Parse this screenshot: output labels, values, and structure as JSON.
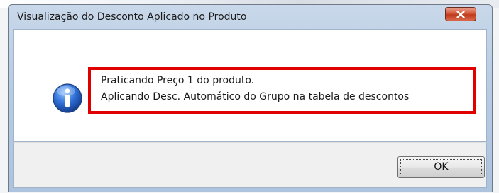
{
  "window": {
    "title": "Visualização do Desconto Aplicado no Produto",
    "close_icon": "close-x-icon",
    "accent_close": "#c9472a"
  },
  "message": {
    "icon": "info-icon",
    "lines": [
      "Praticando Preço 1 do produto.",
      "Aplicando Desc. Automático do Grupo na tabela de descontos"
    ],
    "highlight_color": "#e00000"
  },
  "buttons": {
    "ok_label": "OK"
  }
}
